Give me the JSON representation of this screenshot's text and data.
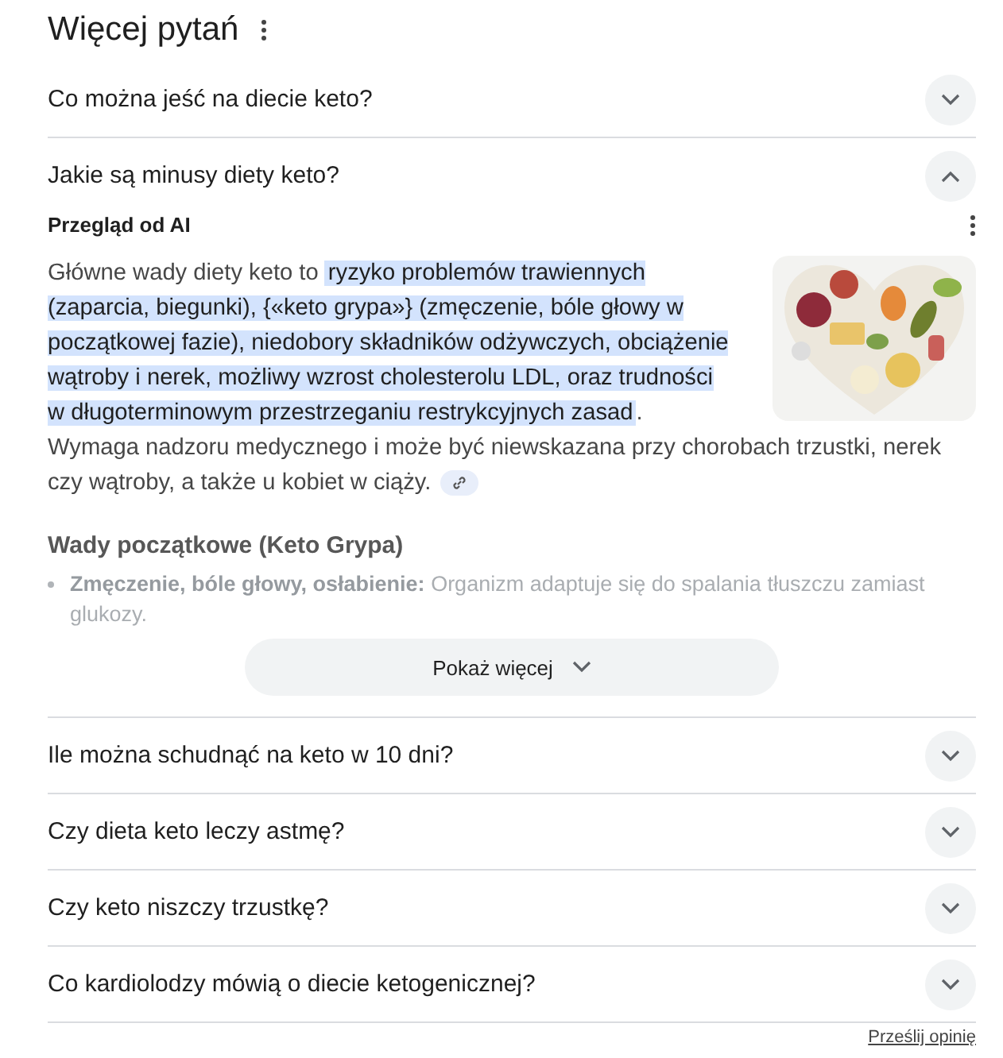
{
  "title": "Więcej pytań",
  "questions": [
    {
      "text": "Co można jeść na diecie keto?",
      "expanded": false
    },
    {
      "text": "Jakie są minusy diety keto?",
      "expanded": true,
      "answer": {
        "label": "Przegląd od AI",
        "text_before": "Główne wady diety keto to ",
        "highlight": "ryzyko problemów trawiennych (zaparcia, biegunki), {«keto grypa»} (zmęczenie, bóle głowy w początkowej fazie), niedobory składników odżywczych, obciążenie wątroby i nerek, możliwy wzrost cholesterolu LDL, oraz trudności w długoterminowym przestrzeganiu restrykcyjnych zasad",
        "text_after": ". Wymaga nadzoru medycznego i może być niewskazana przy chorobach trzustki, nerek czy wątroby, a także u kobiet w ciąży.",
        "section_heading": "Wady początkowe (Keto Grypa)",
        "bullets": [
          "**Zmęczenie, bóle głowy, osłabienie:** Organizm adaptuje się do spalania tłuszczu zamiast glukozy."
        ],
        "show_more": "Pokaż więcej"
      }
    },
    {
      "text": "Ile można schudnąć na keto w 10 dni?",
      "expanded": false
    },
    {
      "text": "Czy dieta keto leczy astmę?",
      "expanded": false
    },
    {
      "text": "Czy keto niszczy trzustkę?",
      "expanded": false
    },
    {
      "text": "Co kardiolodzy mówią o diecie ketogenicznej?",
      "expanded": false
    }
  ],
  "feedback": "Prześlij opinię"
}
